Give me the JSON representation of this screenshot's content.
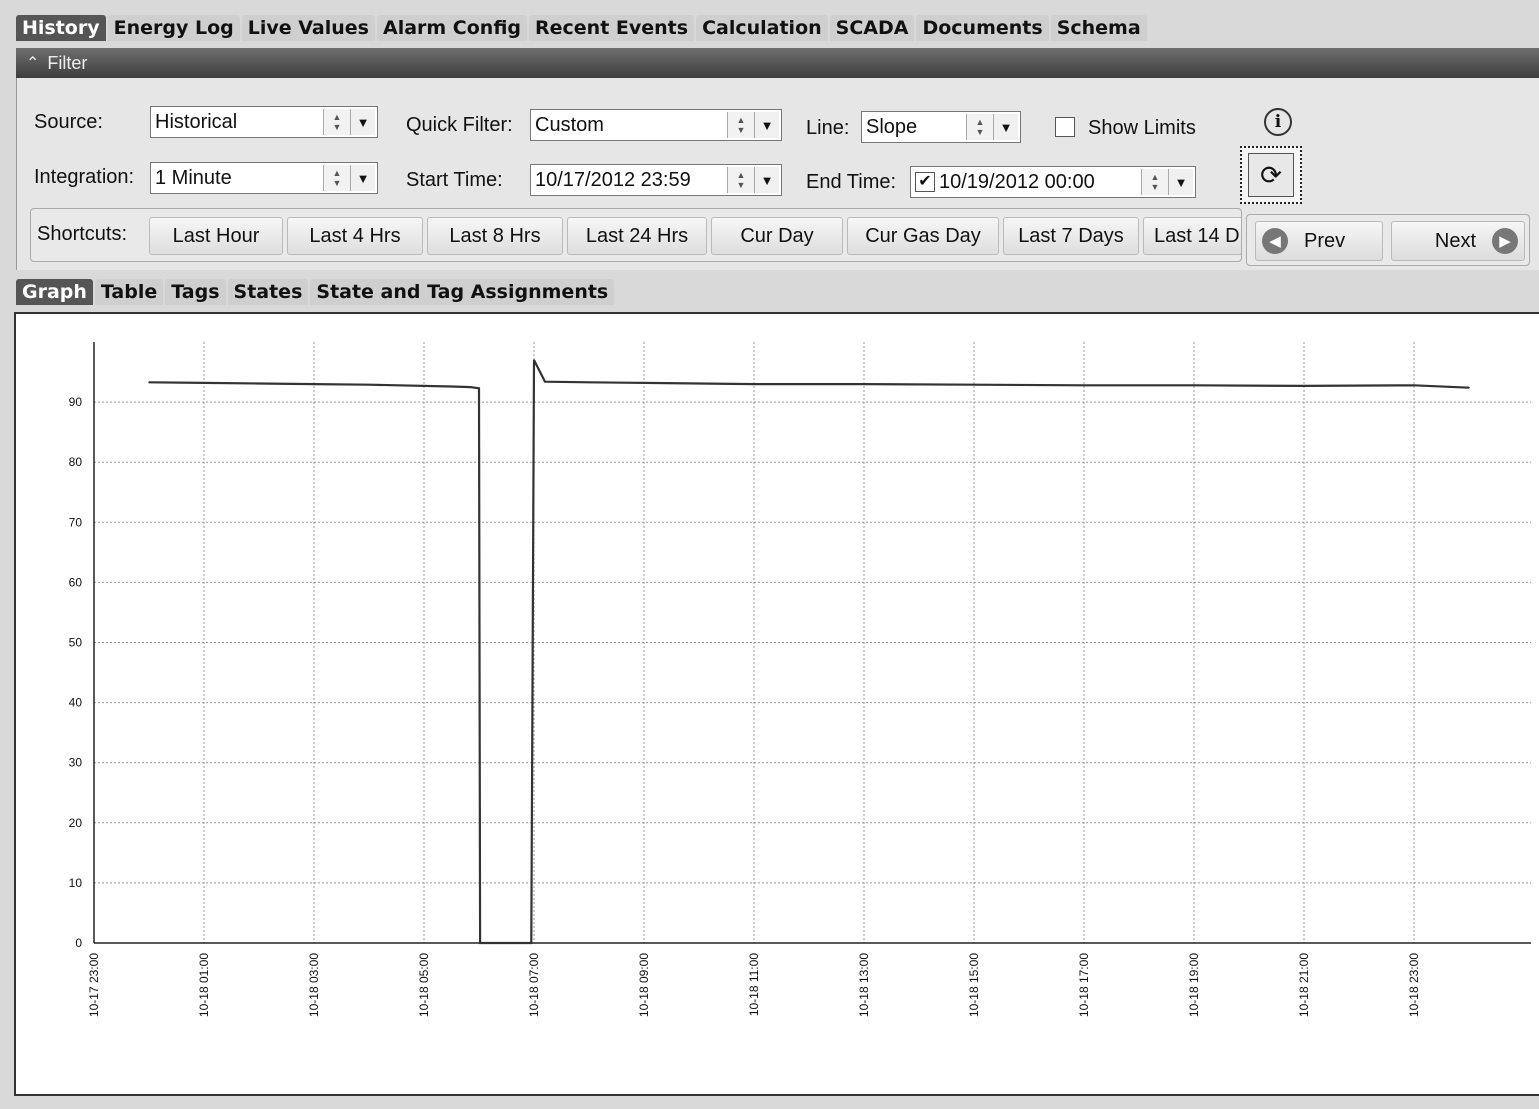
{
  "top_tabs": [
    "History",
    "Energy Log",
    "Live Values",
    "Alarm Config",
    "Recent Events",
    "Calculation",
    "SCADA",
    "Documents",
    "Schema"
  ],
  "filter": {
    "header": "Filter",
    "source_label": "Source:",
    "source_value": "Historical",
    "integration_label": "Integration:",
    "integration_value": "1 Minute",
    "quick_filter_label": "Quick Filter:",
    "quick_filter_value": "Custom",
    "start_time_label": "Start Time:",
    "start_time_value": "10/17/2012 23:59",
    "line_label": "Line:",
    "line_value": "Slope",
    "show_limits_label": "Show Limits",
    "show_limits_checked": false,
    "end_time_label": "End Time:",
    "end_time_value": "10/19/2012 00:00",
    "end_time_enabled": true
  },
  "shortcuts": {
    "label": "Shortcuts:",
    "buttons": [
      "Last Hour",
      "Last 4 Hrs",
      "Last 8 Hrs",
      "Last 24 Hrs",
      "Cur Day",
      "Cur Gas Day",
      "Last 7 Days",
      "Last 14 D"
    ]
  },
  "nav": {
    "prev": "Prev",
    "next": "Next"
  },
  "sub_tabs": [
    "Graph",
    "Table",
    "Tags",
    "States",
    "State and Tag Assignments"
  ],
  "chart_data": {
    "type": "line",
    "y_ticks": [
      0,
      10,
      20,
      30,
      40,
      50,
      60,
      70,
      80,
      90
    ],
    "ylim": [
      0,
      100
    ],
    "x_tick_labels": [
      "10-17 23:00",
      "10-18 01:00",
      "10-18 03:00",
      "10-18 05:00",
      "10-18 07:00",
      "10-18 09:00",
      "10-18 11:00",
      "10-18 13:00",
      "10-18 15:00",
      "10-18 17:00",
      "10-18 19:00",
      "10-18 21:00",
      "10-18 23:00"
    ],
    "x_unit": "hours after 10-17 23:00",
    "xlim": [
      0,
      26
    ],
    "grid": true,
    "series": [
      {
        "points": [
          [
            1.0,
            93.3
          ],
          [
            2.0,
            93.2
          ],
          [
            3.0,
            93.1
          ],
          [
            4.0,
            93.0
          ],
          [
            5.0,
            92.9
          ],
          [
            6.5,
            92.6
          ],
          [
            6.85,
            92.5
          ],
          [
            7.0,
            92.3
          ],
          [
            7.02,
            0.0
          ],
          [
            7.95,
            0.0
          ],
          [
            8.0,
            97.0
          ],
          [
            8.2,
            93.4
          ],
          [
            9.0,
            93.3
          ],
          [
            10.0,
            93.2
          ],
          [
            11.0,
            93.1
          ],
          [
            12.0,
            93.0
          ],
          [
            14.0,
            93.0
          ],
          [
            16.0,
            92.9
          ],
          [
            18.0,
            92.8
          ],
          [
            20.0,
            92.8
          ],
          [
            22.0,
            92.7
          ],
          [
            24.0,
            92.8
          ],
          [
            25.0,
            92.4
          ]
        ]
      }
    ]
  }
}
